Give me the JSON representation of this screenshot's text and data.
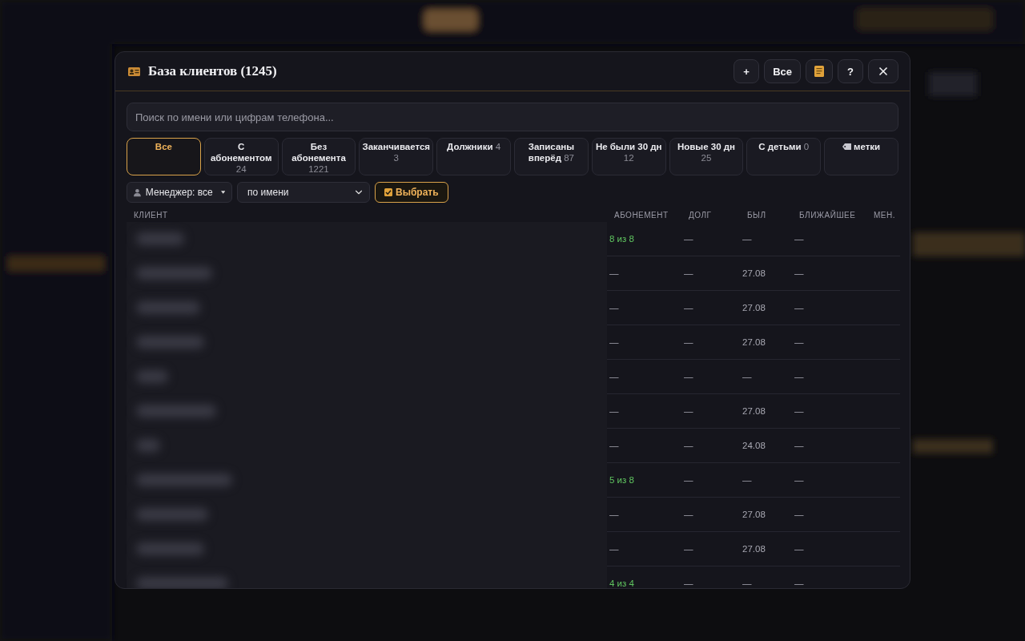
{
  "modal": {
    "title": "База клиентов (1245)",
    "header_buttons": [
      {
        "kind": "text",
        "label": "+"
      },
      {
        "kind": "text",
        "label": "Все"
      },
      {
        "kind": "note"
      },
      {
        "kind": "text",
        "label": "?"
      },
      {
        "kind": "close"
      }
    ]
  },
  "search": {
    "placeholder": "Поиск по имени или цифрам телефона..."
  },
  "filters": [
    {
      "label": "Все",
      "selected": true
    },
    {
      "label": "С абонементом",
      "count": "24",
      "selected": false
    },
    {
      "label": "Без абонемента",
      "count": "1221",
      "selected": false
    },
    {
      "label": "Заканчивается",
      "count": "3",
      "selected": false
    },
    {
      "label": "Должники",
      "count": "4",
      "selected": false
    },
    {
      "label": "Записаны вперёд",
      "count": "87",
      "selected": false
    },
    {
      "label": "Не были 30 дн",
      "count": "12",
      "selected": false
    },
    {
      "label": "Новые 30 дн",
      "count": "25",
      "selected": false
    },
    {
      "label": "С детьми",
      "count": "0",
      "selected": false
    },
    {
      "label": "метки",
      "tag_icon": true,
      "selected": false
    }
  ],
  "manager_select": {
    "value": "Менеджер: все"
  },
  "sort_select": {
    "value": "по имени"
  },
  "select_button": {
    "label": "Выбрать"
  },
  "table": {
    "columns": [
      "КЛИЕНТ",
      "АБОНЕМЕНТ",
      "ДОЛГ",
      "БЫЛ",
      "БЛИЖАЙШЕЕ",
      "МЕН."
    ],
    "rows": [
      {
        "subscription": "8 из 8",
        "active": true,
        "debt": "—",
        "last": "—",
        "next": "—"
      },
      {
        "subscription": "—",
        "active": false,
        "debt": "—",
        "last": "27.08",
        "next": "—"
      },
      {
        "subscription": "—",
        "active": false,
        "debt": "—",
        "last": "27.08",
        "next": "—"
      },
      {
        "subscription": "—",
        "active": false,
        "debt": "—",
        "last": "27.08",
        "next": "—"
      },
      {
        "subscription": "—",
        "active": false,
        "debt": "—",
        "last": "—",
        "next": "—"
      },
      {
        "subscription": "—",
        "active": false,
        "debt": "—",
        "last": "27.08",
        "next": "—"
      },
      {
        "subscription": "—",
        "active": false,
        "debt": "—",
        "last": "24.08",
        "next": "—"
      },
      {
        "subscription": "5 из 8",
        "active": true,
        "debt": "—",
        "last": "—",
        "next": "—"
      },
      {
        "subscription": "—",
        "active": false,
        "debt": "—",
        "last": "27.08",
        "next": "—"
      },
      {
        "subscription": "—",
        "active": false,
        "debt": "—",
        "last": "27.08",
        "next": "—"
      },
      {
        "subscription": "4 из 4",
        "active": true,
        "debt": "—",
        "last": "—",
        "next": "—"
      }
    ]
  }
}
